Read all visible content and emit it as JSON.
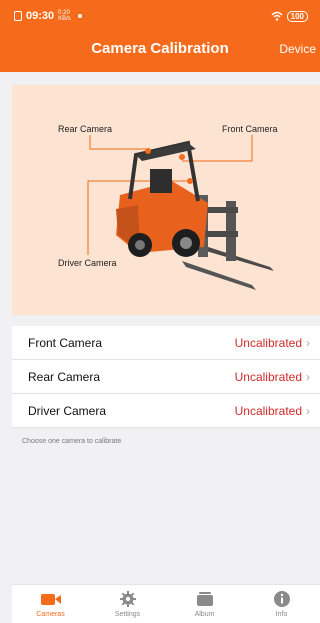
{
  "status_bar": {
    "time": "09:30",
    "net_speed_value": "0.20",
    "net_speed_unit": "KB/s",
    "battery": "100"
  },
  "header": {
    "title": "Camera Calibration",
    "action": "Device"
  },
  "illustration": {
    "labels": {
      "rear": "Rear Camera",
      "front": "Front Camera",
      "driver": "Driver Camera"
    }
  },
  "cameras": [
    {
      "name": "Front Camera",
      "status": "Uncalibrated"
    },
    {
      "name": "Rear Camera",
      "status": "Uncalibrated"
    },
    {
      "name": "Driver Camera",
      "status": "Uncalibrated"
    }
  ],
  "hint": "Choose one camera to calibrate",
  "tabs": [
    {
      "label": "Cameras",
      "icon": "video-camera-icon",
      "active": true
    },
    {
      "label": "Settings",
      "icon": "gear-icon",
      "active": false
    },
    {
      "label": "Album",
      "icon": "album-stack-icon",
      "active": false
    },
    {
      "label": "Info",
      "icon": "info-icon",
      "active": false
    }
  ],
  "colors": {
    "accent": "#f66a1c",
    "uncalibrated": "#d12a2a",
    "hero_bg": "#fce3d2"
  }
}
